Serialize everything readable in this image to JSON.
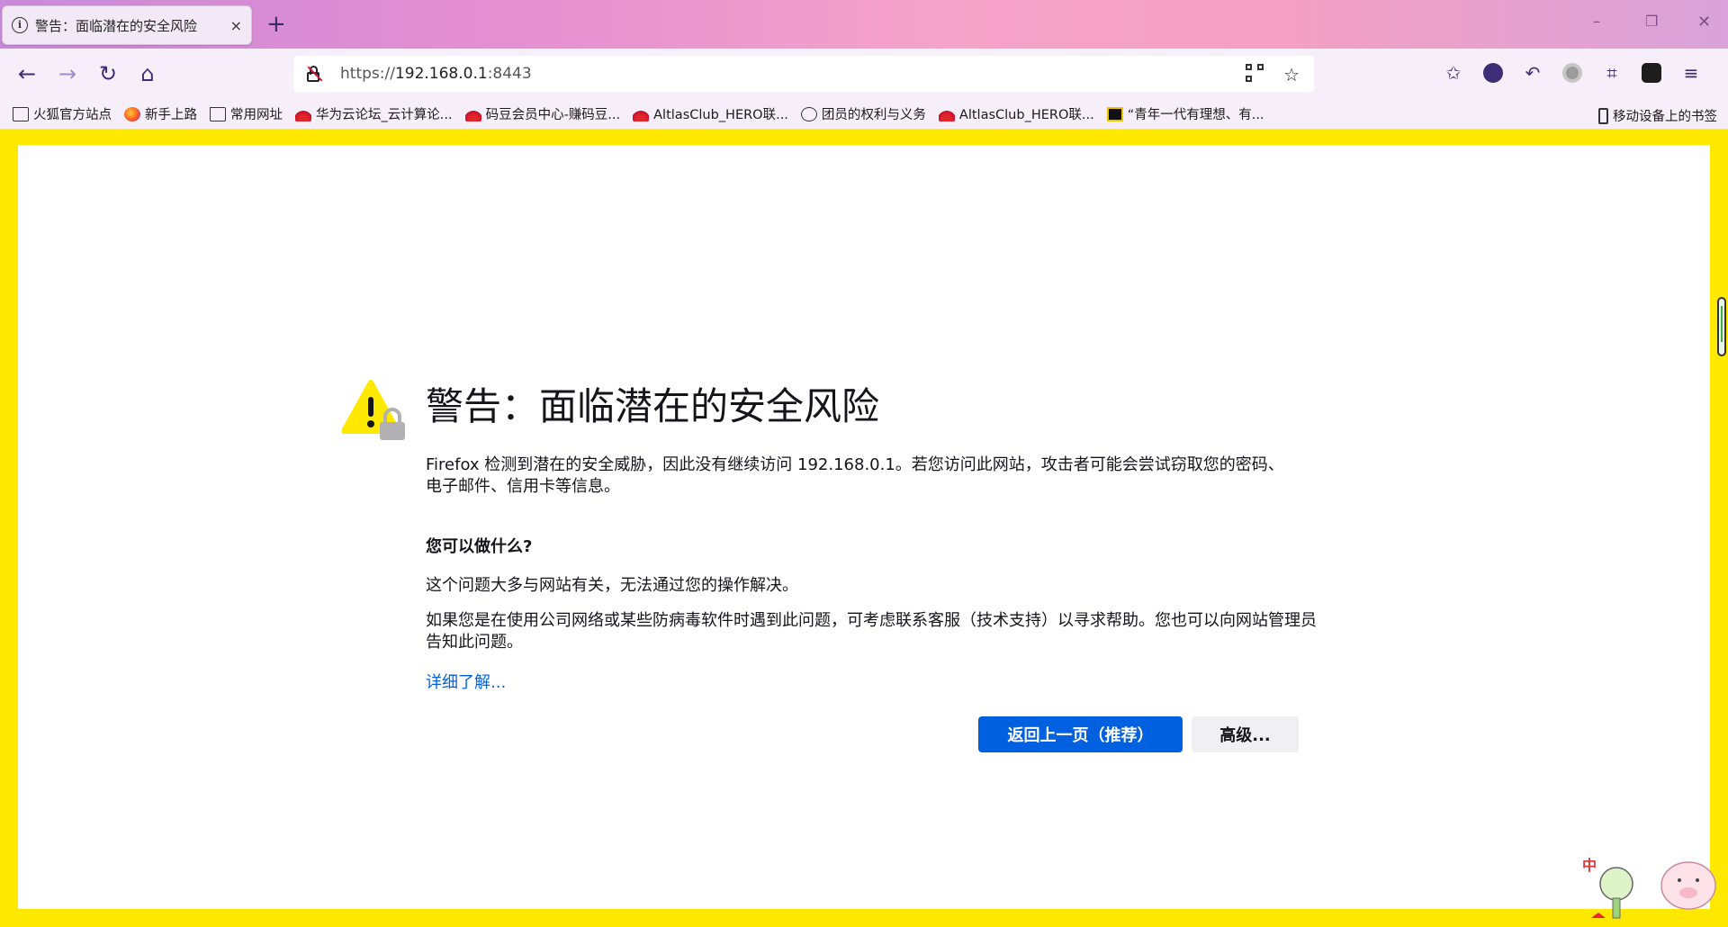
{
  "tab": {
    "title": "警告：面临潜在的安全风险",
    "close": "×",
    "new_tab": "+"
  },
  "window_controls": {
    "minimize": "–",
    "maximize": "❐",
    "close": "✕"
  },
  "nav": {
    "back": "←",
    "forward": "→",
    "reload": "↻",
    "home": "⌂",
    "url_scheme": "https://",
    "url_host": "192.168.0.1",
    "url_port": ":8443",
    "bookmark_star": "☆"
  },
  "toolbar": {
    "pocket": "✩",
    "undo": "↶",
    "crop": "⌗",
    "menu": "≡"
  },
  "bookmarks": [
    {
      "label": "火狐官方站点",
      "icon": "folder-icon"
    },
    {
      "label": "新手上路",
      "icon": "firefox-icon"
    },
    {
      "label": "常用网址",
      "icon": "folder-icon"
    },
    {
      "label": "华为云论坛_云计算论...",
      "icon": "huawei-icon"
    },
    {
      "label": "码豆会员中心-赚码豆...",
      "icon": "huawei-icon"
    },
    {
      "label": "AltlasClub_HERO联...",
      "icon": "huawei-icon"
    },
    {
      "label": "团员的权利与义务",
      "icon": "globe-icon"
    },
    {
      "label": "AltlasClub_HERO联...",
      "icon": "huawei-icon"
    },
    {
      "label": "“青年一代有理想、有...",
      "icon": "cyol-icon"
    }
  ],
  "mobile_bookmarks": "移动设备上的书签",
  "error_page": {
    "heading": "警告：面临潜在的安全风险",
    "description": "Firefox 检测到潜在的安全威胁，因此没有继续访问 192.168.0.1。若您访问此网站，攻击者可能会尝试窃取您的密码、电子邮件、信用卡等信息。",
    "what_can_you_do": "您可以做什么?",
    "para1": "这个问题大多与网站有关，无法通过您的操作解决。",
    "para2": "如果您是在使用公司网络或某些防病毒软件时遇到此问题，可考虑联系客服（技术支持）以寻求帮助。您也可以向网站管理员告知此问题。",
    "learn_more": "详细了解...",
    "go_back_button": "返回上一页（推荐）",
    "advanced_button": "高级..."
  },
  "mascot_text": "中",
  "colors": {
    "accent": "#0061e0",
    "page_border": "#ffe900",
    "warning_yellow": "#ffe900"
  }
}
